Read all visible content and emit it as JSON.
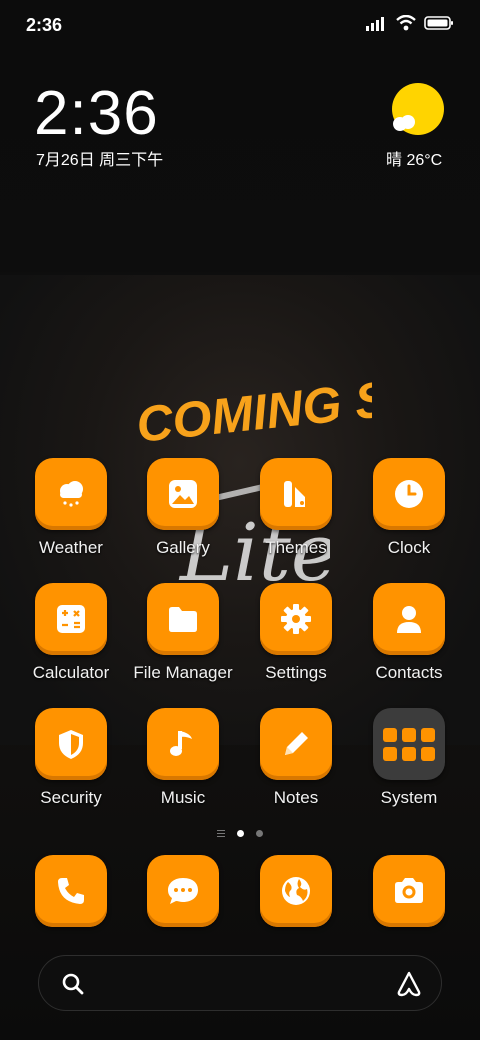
{
  "status_bar": {
    "time": "2:36"
  },
  "clock_widget": {
    "time": "2:36",
    "date": "7月26日 周三下午"
  },
  "weather_widget": {
    "text": "晴 26°C"
  },
  "wallpaper": {
    "headline": "COMING SOON",
    "script": "Lite"
  },
  "apps": [
    {
      "label": "Weather",
      "icon": "weather-icon"
    },
    {
      "label": "Gallery",
      "icon": "gallery-icon"
    },
    {
      "label": "Themes",
      "icon": "themes-icon"
    },
    {
      "label": "Clock",
      "icon": "clock-icon"
    },
    {
      "label": "Calculator",
      "icon": "calculator-icon"
    },
    {
      "label": "File Manager",
      "icon": "folder-icon"
    },
    {
      "label": "Settings",
      "icon": "gear-icon"
    },
    {
      "label": "Contacts",
      "icon": "person-icon"
    },
    {
      "label": "Security",
      "icon": "shield-icon"
    },
    {
      "label": "Music",
      "icon": "music-note-icon"
    },
    {
      "label": "Notes",
      "icon": "pencil-icon"
    },
    {
      "label": "System",
      "icon": "folder-grid-icon"
    }
  ],
  "dock": [
    {
      "icon": "phone-icon"
    },
    {
      "icon": "message-icon"
    },
    {
      "icon": "globe-icon"
    },
    {
      "icon": "camera-icon"
    }
  ],
  "page_indicator": {
    "pages": 2,
    "current": 1
  },
  "colors": {
    "accent": "#ff9300",
    "sun": "#ffd400",
    "background": "#0b0b0b"
  }
}
